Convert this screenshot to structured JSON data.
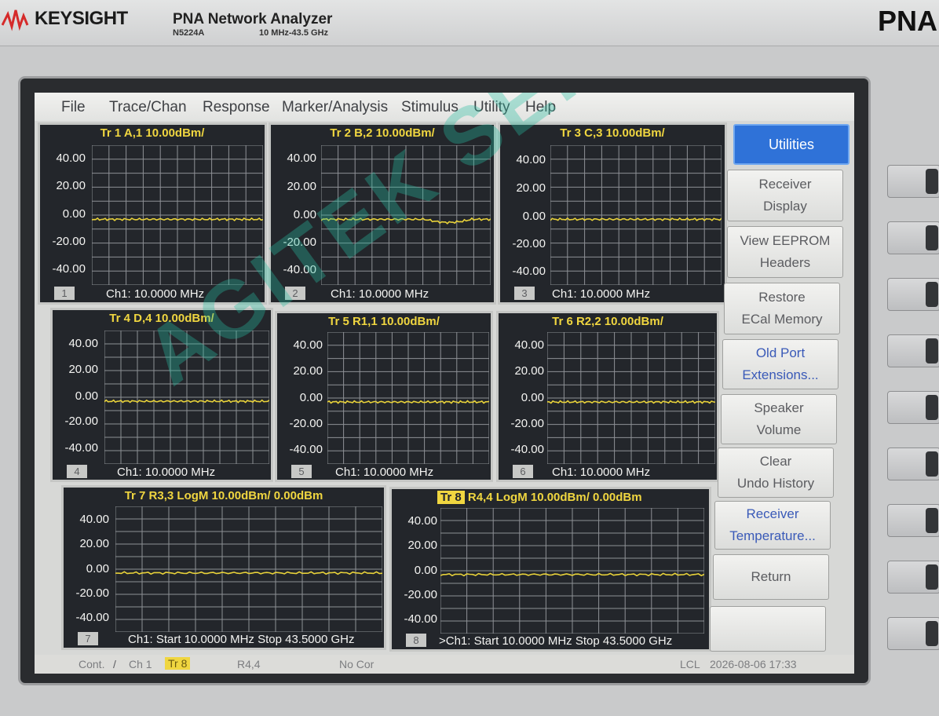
{
  "header": {
    "brand": "KEYSIGHT",
    "product_title": "PNA Network Analyzer",
    "model": "N5224A",
    "freq_range": "10 MHz-43.5 GHz",
    "series_mark": "PNA",
    "logo_icon": "keysight-wave-icon",
    "logo_color": "#d52a2a"
  },
  "menu": [
    "File",
    "Trace/Chan",
    "Response",
    "Marker/Analysis",
    "Stimulus",
    "Utility",
    "Help"
  ],
  "watermark": "AGITEK SERVICE",
  "windows": [
    {
      "num": "1",
      "title": "Tr  1  A,1 10.00dBm/",
      "y_labels": [
        "40.00",
        "20.00",
        "0.00",
        "-20.00",
        "-40.00"
      ],
      "footer": "Ch1:  10.0000 MHz",
      "trace_y": 0
    },
    {
      "num": "2",
      "title": "Tr  2  B,2 10.00dBm/",
      "y_labels": [
        "40.00",
        "20.00",
        "0.00",
        "-20.00",
        "-40.00"
      ],
      "footer": "Ch1:  10.0000 MHz",
      "trace_y": 0
    },
    {
      "num": "3",
      "title": "Tr  3  C,3 10.00dBm/",
      "y_labels": [
        "40.00",
        "20.00",
        "0.00",
        "-20.00",
        "-40.00"
      ],
      "footer": "Ch1:  10.0000 MHz",
      "trace_y": 0
    },
    {
      "num": "4",
      "title": "Tr  4  D,4 10.00dBm/",
      "y_labels": [
        "40.00",
        "20.00",
        "0.00",
        "-20.00",
        "-40.00"
      ],
      "footer": "Ch1:  10.0000 MHz",
      "trace_y": 0
    },
    {
      "num": "5",
      "title": "Tr  5  R1,1 10.00dBm/",
      "y_labels": [
        "40.00",
        "20.00",
        "0.00",
        "-20.00",
        "-40.00"
      ],
      "footer": "Ch1:  10.0000 MHz",
      "trace_y": 0
    },
    {
      "num": "6",
      "title": "Tr  6  R2,2 10.00dBm/",
      "y_labels": [
        "40.00",
        "20.00",
        "0.00",
        "-20.00",
        "-40.00"
      ],
      "footer": "Ch1:  10.0000 MHz",
      "trace_y": 0
    },
    {
      "num": "7",
      "title": "Tr  7  R3,3 LogM 10.00dBm/  0.00dBm",
      "y_labels": [
        "40.00",
        "20.00",
        "0.00",
        "-20.00",
        "-40.00"
      ],
      "footer": "Ch1:  Start   10.0000 MHz       Stop  43.5000 GHz",
      "trace_y": 0
    },
    {
      "num": "8",
      "title_tr": "Tr  8",
      "title": "  R4,4 LogM 10.00dBm/  0.00dBm",
      "y_labels": [
        "40.00",
        "20.00",
        "0.00",
        "-20.00",
        "-40.00"
      ],
      "footer": ">Ch1:  Start   10.0000 MHz       Stop  43.5000 GHz",
      "trace_y": 0
    }
  ],
  "softkeys": [
    {
      "label": "Utilities"
    },
    {
      "label": "Receiver Display"
    },
    {
      "label": "View EEPROM Headers"
    },
    {
      "label": "Restore ECal Memory"
    },
    {
      "label": "Old Port Extensions..."
    },
    {
      "label": "Speaker Volume"
    },
    {
      "label": "Clear Undo History"
    },
    {
      "label": "Receiver Temperature..."
    },
    {
      "label": "Return"
    },
    {
      "label": ""
    }
  ],
  "status": {
    "mode": "Cont.",
    "channel": "Ch 1",
    "trace": "Tr 8",
    "param": "R4,4",
    "correction": "No Cor",
    "control": "LCL",
    "datetime": "2026-08-06 17:33"
  },
  "colors": {
    "trace": "#e8d23a",
    "grid_bg": "#23262b",
    "grid_line": "#8e9196",
    "title": "#f0d640",
    "accent": "#2f72d8"
  }
}
